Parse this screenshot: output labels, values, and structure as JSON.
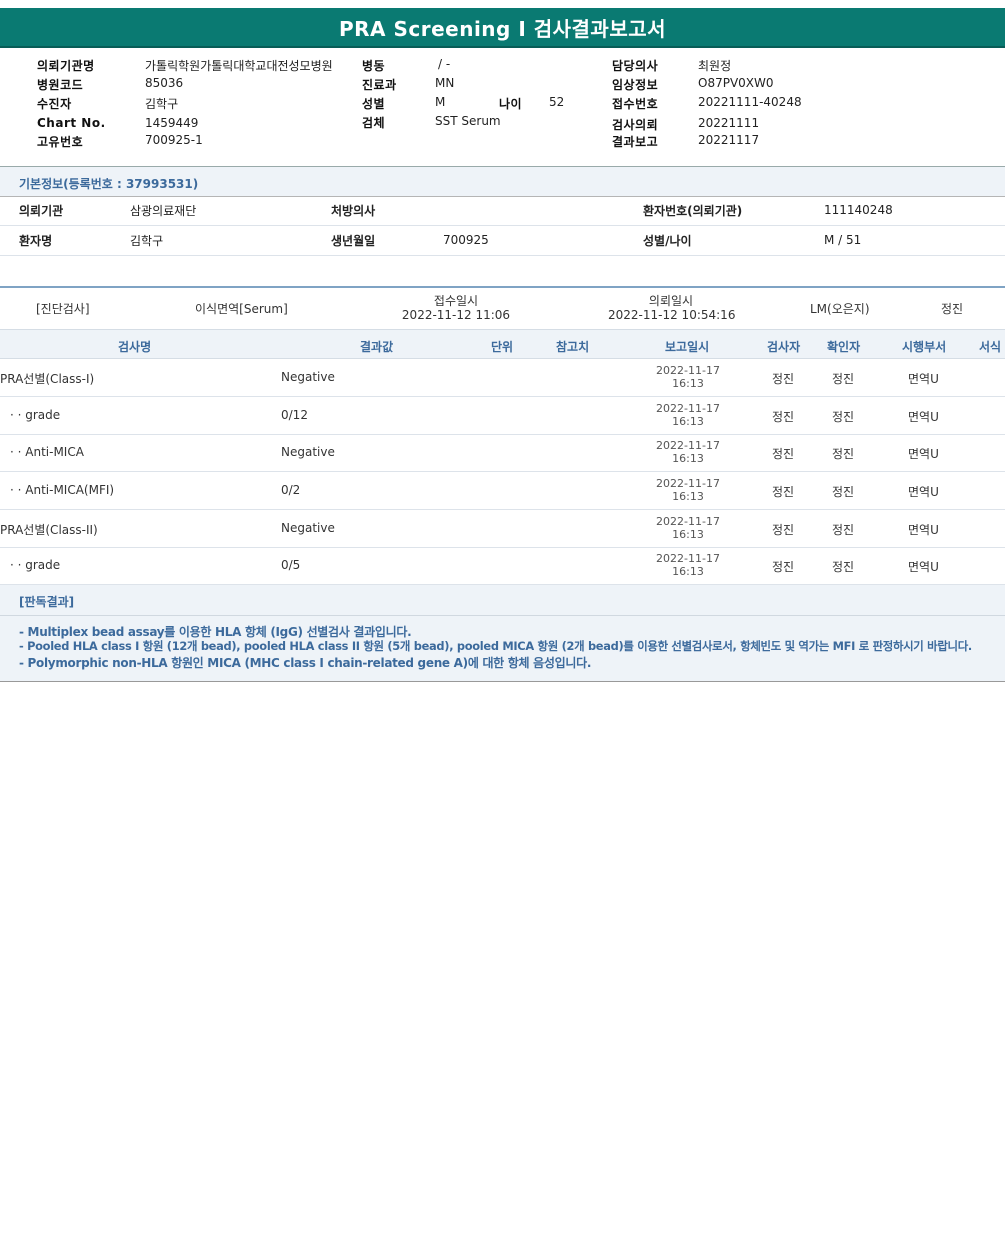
{
  "title": "PRA Screening I 검사결과보고서",
  "header": {
    "requester_label": "의뢰기관명",
    "requester": "가톨릭학원가톨릭대학교대전성모병원",
    "hospital_code_label": "병원코드",
    "hospital_code": "85036",
    "patient_label": "수진자",
    "patient": "김학구",
    "chart_label": "Chart No.",
    "chart": "1459449",
    "unique_label": "고유번호",
    "unique": "700925-1",
    "ward_label": "병동",
    "ward": "/ -",
    "dept_label": "진료과",
    "dept": "MN",
    "sex_label": "성별",
    "sex": "M",
    "age_label": "나이",
    "age": "52",
    "specimen_label": "검체",
    "specimen": "SST Serum",
    "doctor_label": "담당의사",
    "doctor": "최원정",
    "clinical_label": "임상정보",
    "clinical": "O87PV0XW0",
    "receipt_label": "접수번호",
    "receipt": "20221111-40248",
    "request_label": "검사의뢰",
    "request": "20221111",
    "report_label": "결과보고",
    "report": "20221117"
  },
  "basic": {
    "section_title": "기본정보(등록번호 : 37993531)",
    "inst_label": "의뢰기관",
    "inst": "삼광의료재단",
    "presc_label": "처방의사",
    "presc": "",
    "pid_label": "환자번호(의뢰기관)",
    "pid": "111140248",
    "name_label": "환자명",
    "name": "김학구",
    "birth_label": "생년월일",
    "birth": "700925",
    "sexage_label": "성별/나이",
    "sexage": "M / 51"
  },
  "order": {
    "category": "[진단검사]",
    "dept": "이식면역[Serum]",
    "received_label": "접수일시",
    "received": "2022-11-12  11:06",
    "requested_label": "의뢰일시",
    "requested": "2022-11-12  10:54:16",
    "reviewer": "LM(오은지)",
    "tester": "정진"
  },
  "table": {
    "headers": {
      "name": "검사명",
      "result": "결과값",
      "unit": "단위",
      "ref": "참고치",
      "reported": "보고일시",
      "tester": "검사자",
      "checker": "확인자",
      "dept": "시행부서",
      "form": "서식"
    },
    "rows": [
      {
        "name": "PRA선별(Class-I)",
        "result": "Negative",
        "date": "2022-11-17",
        "time": "16:13",
        "tester": "정진",
        "checker": "정진",
        "dept": "면역U"
      },
      {
        "name": "· · grade",
        "result": "0/12",
        "date": "2022-11-17",
        "time": "16:13",
        "tester": "정진",
        "checker": "정진",
        "dept": "면역U"
      },
      {
        "name": "· · Anti-MICA",
        "result": "Negative",
        "date": "2022-11-17",
        "time": "16:13",
        "tester": "정진",
        "checker": "정진",
        "dept": "면역U"
      },
      {
        "name": "· · Anti-MICA(MFI)",
        "result": "0/2",
        "date": "2022-11-17",
        "time": "16:13",
        "tester": "정진",
        "checker": "정진",
        "dept": "면역U"
      },
      {
        "name": "PRA선별(Class-II)",
        "result": "Negative",
        "date": "2022-11-17",
        "time": "16:13",
        "tester": "정진",
        "checker": "정진",
        "dept": "면역U"
      },
      {
        "name": "· · grade",
        "result": "0/5",
        "date": "2022-11-17",
        "time": "16:13",
        "tester": "정진",
        "checker": "정진",
        "dept": "면역U"
      }
    ]
  },
  "judgment": {
    "title": "[판독결과]",
    "lines": [
      "- Multiplex bead assay를 이용한 HLA 항체 (IgG) 선별검사 결과입니다.",
      "- Pooled HLA class I 항원 (12개 bead), pooled HLA class II 항원 (5개 bead), pooled MICA 항원 (2개 bead)를 이용한 선별검사로서, 항체빈도 및 역가는 MFI 로 판정하시기 바랍니다.",
      "- Polymorphic non-HLA 항원인 MICA (MHC class I chain-related gene A)에 대한 항체 음성입니다."
    ]
  }
}
